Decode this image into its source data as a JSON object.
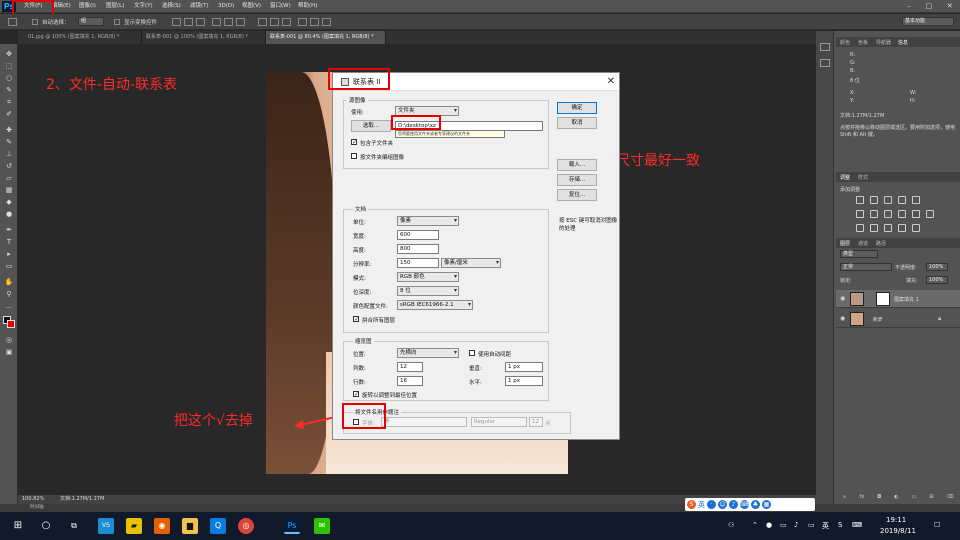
{
  "menu": {
    "logo": "Ps",
    "items": [
      "文件(F)",
      "编辑(E)",
      "图像(I)",
      "图层(L)",
      "文字(Y)",
      "选择(S)",
      "滤镜(T)",
      "3D(D)",
      "视图(V)",
      "窗口(W)",
      "帮助(H)"
    ]
  },
  "options": {
    "auto_select_label": "自动选择：",
    "auto_select_value": "组",
    "show_transform_label": "显示变换控件",
    "workspace": "基本功能"
  },
  "tabs": [
    "01.jpg @ 100% (图案填充 1, RGB/8) *",
    "联系表-001 @ 100% (图案填充 1, RGB/8) *",
    "联系表-001 @ 80.4% (图案填充 1, RGB/8) *"
  ],
  "annotations": {
    "step": "2、文件-自动-联系表",
    "folder_hint": "选取存放照片的文件夹，图片的尺寸最好一致",
    "uncheck_hint": "把这个√去掉"
  },
  "dialog": {
    "title": "联系表 II",
    "close": "✕",
    "source": {
      "group_label": "源图像",
      "use_label": "使用:",
      "use_value": "文件夹",
      "choose_button": "选取...",
      "path": "D:\\desktop\\xz",
      "tooltip": "您将要使用文件夹或者专家建议的文件夹",
      "include_subfolders": "包含子文件夹",
      "group_by_folder": "按文件夹编组图像"
    },
    "buttons": {
      "ok": "确定",
      "cancel": "取消",
      "load": "载入...",
      "save": "存储...",
      "reset": "复位..."
    },
    "esc_note": "按 ESC 键可取消对图像的处理",
    "document": {
      "group_label": "文档",
      "unit_label": "单位:",
      "unit_value": "像素",
      "width_label": "宽度:",
      "width_value": "600",
      "height_label": "高度:",
      "height_value": "800",
      "res_label": "分辨率:",
      "res_value": "150",
      "res_unit": "像素/厘米",
      "mode_label": "模式:",
      "mode_value": "RGB 颜色",
      "depth_label": "位深度:",
      "depth_value": "8 位",
      "profile_label": "颜色配置文件:",
      "profile_value": "sRGB IEC61966-2.1",
      "flatten": "拼合所有图层"
    },
    "thumbnails": {
      "group_label": "缩览图",
      "place_label": "位置:",
      "place_value": "先横向",
      "auto_spacing": "使用自动间距",
      "cols_label": "列数:",
      "cols_value": "12",
      "rows_label": "行数:",
      "rows_value": "16",
      "vert_label": "垂直:",
      "vert_value": "1 px",
      "horiz_label": "水平:",
      "horiz_value": "1 px",
      "rotate": "旋转以调整到最佳位置"
    },
    "caption": {
      "group_label": "将文件名用作题注",
      "font_label": "字体:",
      "font_value": "黑",
      "style_value": "Regular",
      "size_value": "12",
      "size_unit": "点"
    }
  },
  "right_panel": {
    "top_tabs": [
      "颜色",
      "色板",
      "导航器",
      "信息"
    ],
    "info_rows": [
      "R:",
      "G:",
      "B:",
      "8 位",
      "X:",
      "Y:",
      "W:",
      "H:"
    ],
    "doc_info": "文档:1.27M/1.27M",
    "hint": "点按并拖移以移动图层或选区。要用附加选项，使用 Shift 和 Alt 键。",
    "adj_tabs": [
      "调整",
      "样式"
    ],
    "adj_title": "添加调整",
    "layer_tabs": [
      "图层",
      "通道",
      "路径"
    ],
    "layer_kind": "类型",
    "blend": "正常",
    "opacity_label": "不透明度:",
    "opacity": "100%",
    "lock_label": "锁定:",
    "fill_label": "填充:",
    "fill": "100%",
    "layers": [
      {
        "name": "图案填充 1"
      },
      {
        "name": "背景"
      }
    ]
  },
  "status": {
    "zoom": "100.82%",
    "doc": "文档:1.27M/1.27M",
    "timeline": "时间轴"
  },
  "taskbar": {
    "ime_lang": "英",
    "tray_lang": "英",
    "time": "19:11",
    "date": "2019/8/11"
  },
  "colors": {
    "annotation": "#ff2a2a",
    "ps_bg": "#282828",
    "panel": "#535353",
    "taskbar": "#101a2a"
  }
}
